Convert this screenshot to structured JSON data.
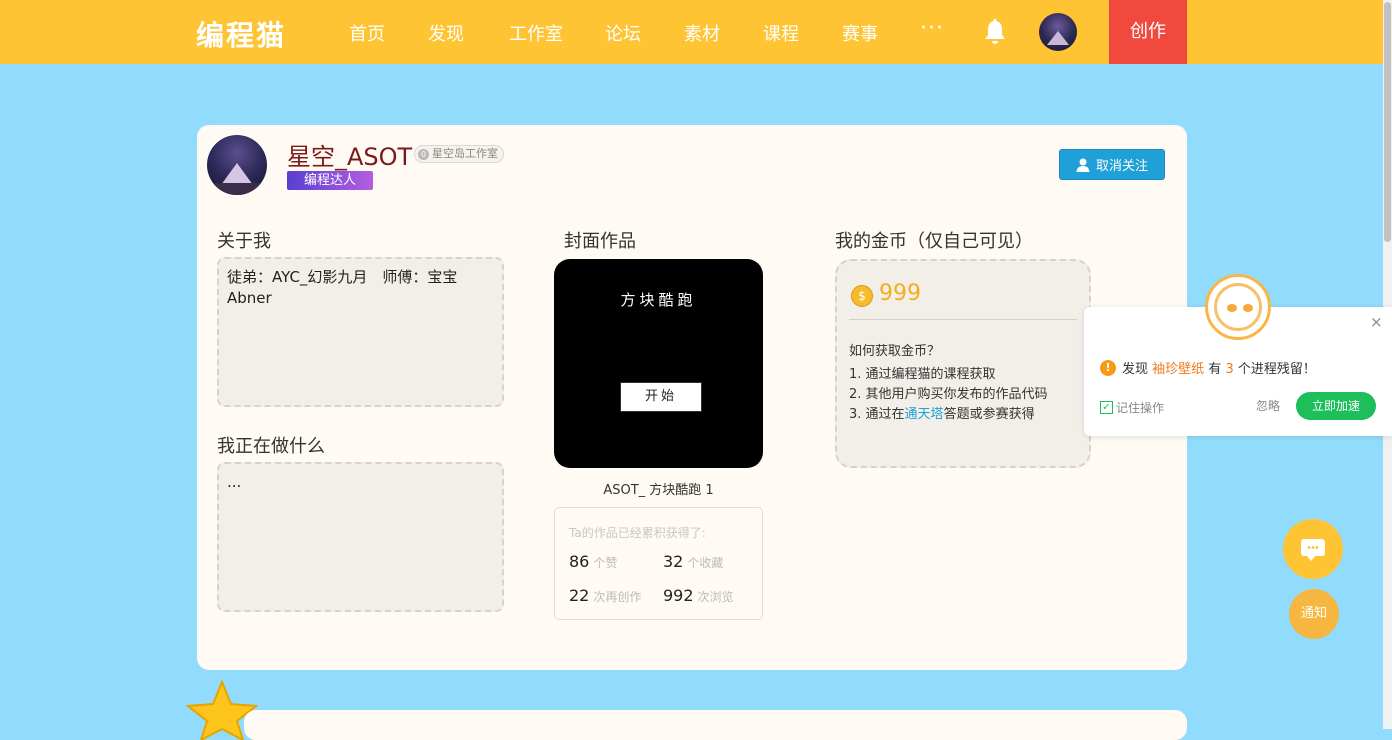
{
  "nav": {
    "logo": "编程猫",
    "items": [
      "首页",
      "发现",
      "工作室",
      "论坛",
      "素材",
      "课程",
      "赛事"
    ],
    "more": "···",
    "create": "创作"
  },
  "profile": {
    "username": "星空_ASOT",
    "studio_icon_text": "0",
    "studio": "星空岛工作室",
    "tag": "编程达人",
    "unfollow": "取消关注"
  },
  "about": {
    "title": "关于我",
    "content": "徒弟：AYC_幻影九月　师傅：宝宝Abner"
  },
  "doing": {
    "title": "我正在做什么",
    "content": "..."
  },
  "cover": {
    "title": "封面作品",
    "art_title": "方块酷跑",
    "art_button": "开始",
    "work_name": "ASOT_ 方块酷跑 1",
    "stats_head": "Ta的作品已经累积获得了:",
    "stats": [
      {
        "value": "86",
        "unit": "个赞"
      },
      {
        "value": "32",
        "unit": "个收藏"
      },
      {
        "value": "22",
        "unit": "次再创作"
      },
      {
        "value": "992",
        "unit": "次浏览"
      }
    ]
  },
  "coins": {
    "title": "我的金币（仅自己可见）",
    "icon_text": "$",
    "amount": "999",
    "how_title": "如何获取金币？",
    "way1": "1. 通过编程猫的课程获取",
    "way2": "2. 其他用户购买你发布的作品代码",
    "way3_pre": "3. 通过在",
    "way3_link": "通天塔",
    "way3_post": "答题或参赛获得"
  },
  "popup": {
    "close": "×",
    "warn": "!",
    "msg_pre": "发现",
    "app": "袖珍壁纸",
    "msg_mid": "有",
    "count": "3",
    "msg_post": "个进程残留！",
    "check_mark": "✓",
    "remember": "记住操作",
    "ignore": "忽略",
    "speed_up": "立即加速"
  },
  "float": {
    "notice": "通知"
  },
  "colors": {
    "background": "#91dcfc",
    "topbar": "#fec433",
    "create": "#f2493e",
    "accent_blue": "#1fa0d8",
    "green": "#1dbf5a"
  }
}
